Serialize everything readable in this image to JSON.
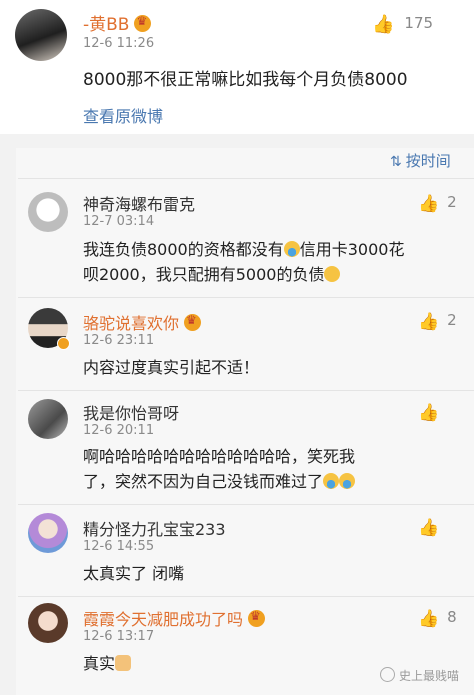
{
  "main_post": {
    "author": "-黄BB",
    "timestamp": "12-6 11:26",
    "text": "8000那不很正常嘛比如我每个月负债8000",
    "likes": "175",
    "link": "查看原微博"
  },
  "sort_label": "按时间",
  "comments": [
    {
      "name": "神奇海螺布雷克",
      "timestamp": "12-7 03:14",
      "text_lines": [
        "我连负债8000的资格都没有",
        "信用卡3000花",
        "呗2000，我只配拥有5000的负债"
      ],
      "likes": "2"
    },
    {
      "name": "骆驼说喜欢你",
      "timestamp": "12-6 23:11",
      "text": "内容过度真实引起不适！",
      "likes": "2"
    },
    {
      "name": "我是你怡哥呀",
      "timestamp": "12-6 20:11",
      "text_lines": [
        "啊哈哈哈哈哈哈哈哈哈哈哈哈，笑死我",
        "了，突然不因为自己没钱而难过了"
      ],
      "likes": ""
    },
    {
      "name": "精分怪力孔宝宝233",
      "timestamp": "12-6 14:55",
      "text": "太真实了  闭嘴",
      "likes": ""
    },
    {
      "name": "霞霞今天减肥成功了吗",
      "timestamp": "12-6 13:17",
      "text": "真实",
      "likes": "8"
    }
  ],
  "watermark": "史上最贱喵",
  "colors": {
    "vip_name": "#e07030",
    "link": "#4a78b0",
    "meta": "#8a8a8a"
  }
}
